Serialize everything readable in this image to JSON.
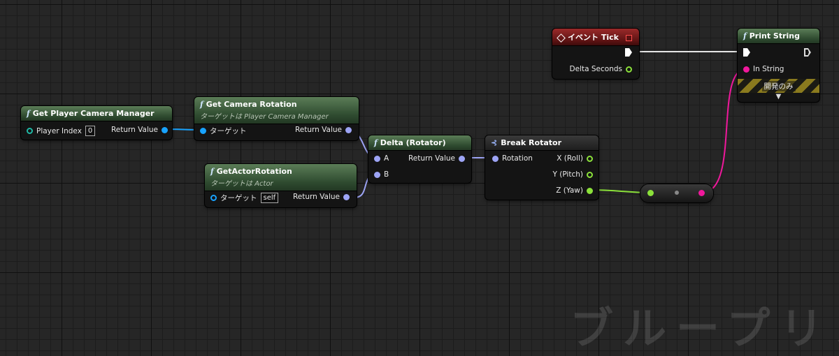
{
  "colors": {
    "wire_exec": "#ffffff",
    "wire_object": "#18a3ff",
    "wire_rotator": "#9da4f5",
    "wire_float": "#8be13a",
    "wire_string": "#f0189c"
  },
  "watermark": "ブループリント",
  "nodes": {
    "get_pcm": {
      "title": "Get Player Camera Manager",
      "icon": "function-icon",
      "in_label": "Player Index",
      "in_value": "0",
      "out_label": "Return Value"
    },
    "get_cam_rot": {
      "title": "Get Camera Rotation",
      "subtitle": "ターゲットは Player Camera Manager",
      "icon": "function-icon",
      "in_label": "ターゲット",
      "out_label": "Return Value"
    },
    "get_actor_rot": {
      "title": "GetActorRotation",
      "subtitle": "ターゲットは Actor",
      "icon": "function-icon",
      "in_label": "ターゲット",
      "in_value": "self",
      "out_label": "Return Value"
    },
    "delta_rot": {
      "title": "Delta (Rotator)",
      "icon": "function-icon",
      "in_a": "A",
      "in_b": "B",
      "out_label": "Return Value"
    },
    "break_rot": {
      "title": "Break Rotator",
      "icon": "break-struct-icon",
      "in_label": "Rotation",
      "out_x": "X (Roll)",
      "out_y": "Y (Pitch)",
      "out_z": "Z (Yaw)"
    },
    "event_tick": {
      "title": "イベント Tick",
      "icon": "event-icon",
      "out_label": "Delta Seconds"
    },
    "print_string": {
      "title": "Print String",
      "icon": "function-icon",
      "in_label": "In String",
      "dev_only": "開発のみ"
    }
  }
}
